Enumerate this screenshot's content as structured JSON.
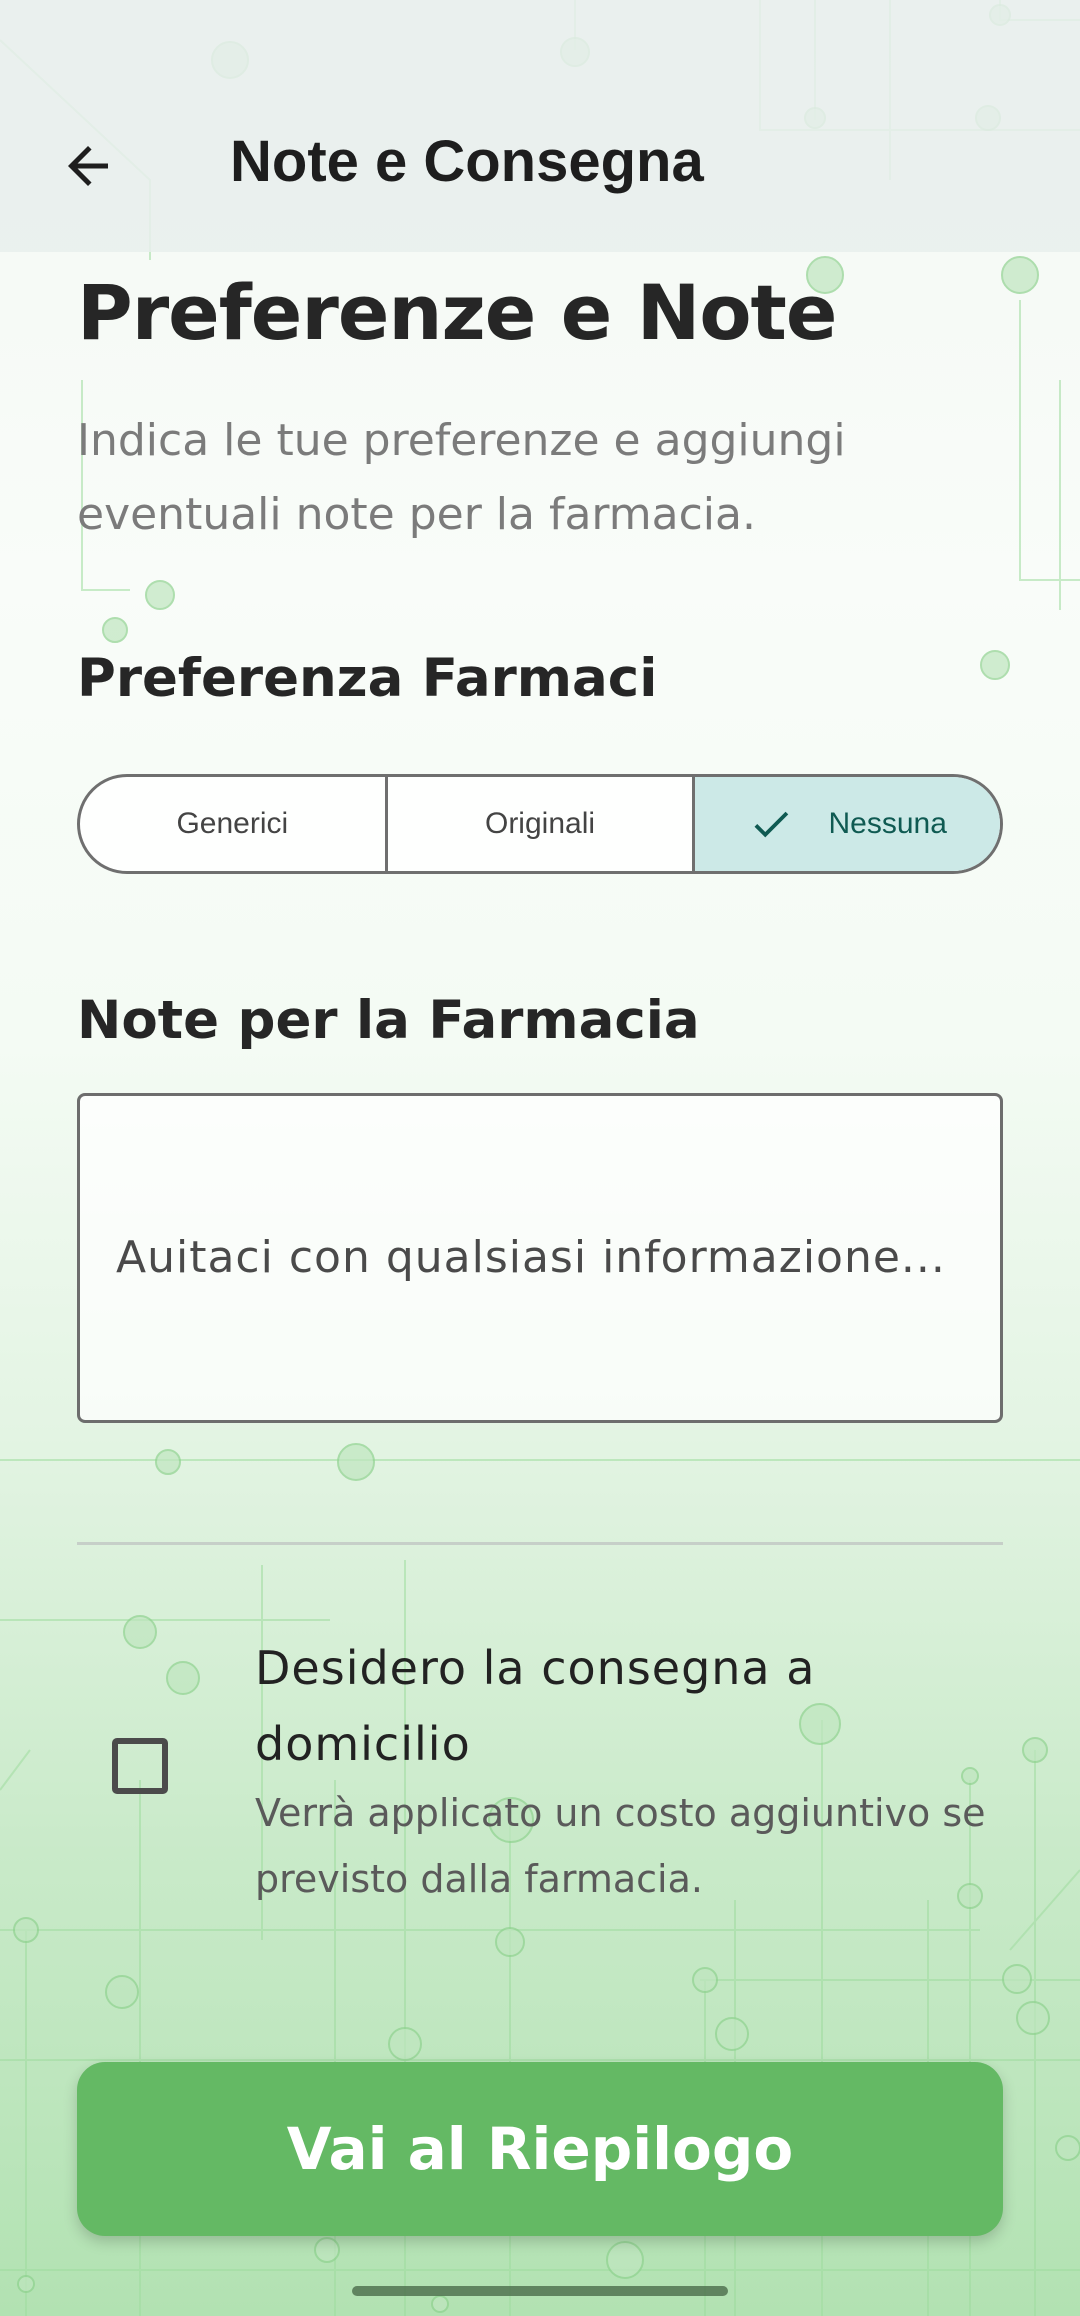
{
  "header": {
    "title": "Note e Consegna",
    "back_icon": "arrow-left-icon"
  },
  "page": {
    "title": "Preferenze e Note",
    "subtitle": "Indica le tue preferenze e aggiungi eventuali note per la farmacia."
  },
  "drug_preference": {
    "title": "Preferenza Farmaci",
    "options": [
      "Generici",
      "Originali",
      "Nessuna"
    ],
    "selected": "Nessuna",
    "selected_icon": "check-icon"
  },
  "notes": {
    "title": "Note per la Farmacia",
    "placeholder": "Auitaci con qualsiasi informazione...",
    "value": ""
  },
  "delivery": {
    "label": "Desidero la consegna a domicilio",
    "description": "Verrà applicato un costo aggiuntivo se previsto dalla farmacia.",
    "checked": false
  },
  "cta": {
    "label": "Vai al Riepilogo"
  },
  "colors": {
    "accent": "#64b964",
    "selected_segment_bg": "#cce9e7",
    "selected_segment_text": "#0f5a52"
  }
}
